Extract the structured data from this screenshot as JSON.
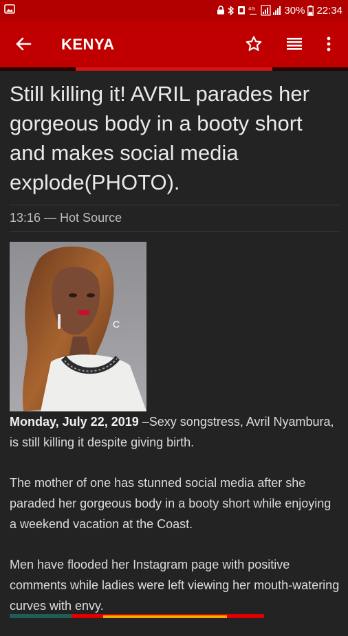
{
  "status_bar": {
    "battery": "30%",
    "time": "22:34",
    "icons": [
      "image-notification-icon",
      "lock-icon",
      "bluetooth-icon",
      "nfc-icon",
      "wifi-icon",
      "signal-icon",
      "battery-icon"
    ]
  },
  "app_bar": {
    "title": "KENYA",
    "icons": [
      "back-arrow-icon",
      "star-icon",
      "list-icon",
      "more-vert-icon"
    ]
  },
  "article": {
    "headline": "Still killing it! AVRIL parades her gorgeous body in a booty short and makes social media explode(PHOTO).",
    "meta": "13:16 — Hot Source",
    "date": "Monday, July 22, 2019",
    "lead": " –Sexy songstress, Avril Nyambura, is still killing it despite giving birth.",
    "paragraph_2": "The mother of one has stunned social media after she paraded her gorgeous body in a booty short while enjoying a weekend vacation at the Coast.",
    "paragraph_3": "Men have flooded her Instagram page with positive comments while ladies were left viewing her mouth-watering curves with envy."
  },
  "colors": {
    "app_bar": "#c00000",
    "status_bar": "#b20000",
    "background": "#232323",
    "text": "#e6e6e6"
  }
}
